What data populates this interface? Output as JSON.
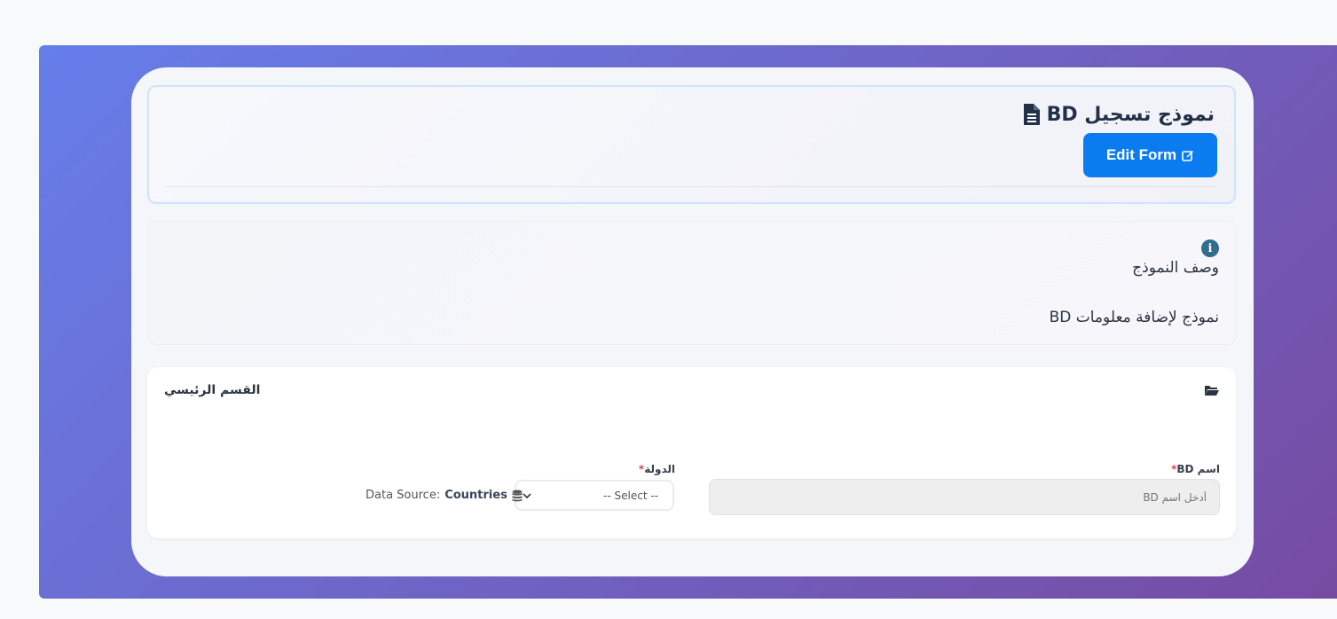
{
  "header": {
    "title": "نموذج تسجيل BD",
    "edit_button_label": "Edit Form",
    "title_icon": "file-icon",
    "edit_icon": "edit-icon"
  },
  "description": {
    "label": "وصف النموذج",
    "value": "نموذج لإضافة معلومات BD",
    "icon": "info-icon"
  },
  "section": {
    "title": "القسم الرئيسي",
    "icon": "folder-open-icon",
    "fields": {
      "name": {
        "label": "اسم BD",
        "required_mark": "*",
        "placeholder": "أدخل اسم BD"
      },
      "country": {
        "label": "الدولة",
        "required_mark": "*",
        "selected": "-- Select --",
        "data_source_label": "Data Source:",
        "data_source_value": "Countries"
      }
    }
  },
  "colors": {
    "gradient_start": "#667eea",
    "gradient_end": "#764ba2",
    "primary": "#0a7cf0",
    "required": "#e0405a"
  }
}
